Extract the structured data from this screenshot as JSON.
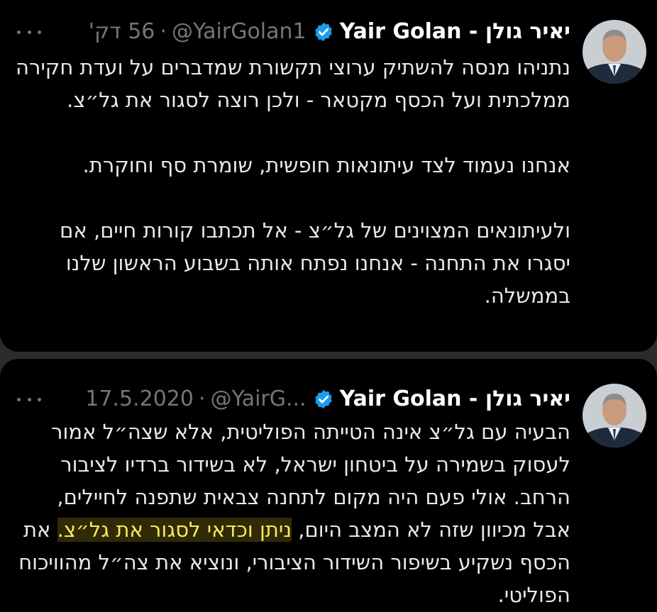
{
  "tweets": [
    {
      "author_name": "Yair Golan - יאיר גולן",
      "handle": "@YairGolan1",
      "time": "56 דק'",
      "paragraphs": [
        "נתניהו מנסה להשתיק ערוצי תקשורת שמדברים על ועדת חקירה ממלכתית ועל הכסף מקטאר - ולכן רוצה לסגור את גל״צ.",
        "אנחנו נעמוד לצד עיתונאות חופשית, שומרת סף וחוקרת.",
        "ולעיתונאים המצוינים של גל״צ - אל תכתבו קורות חיים, אם יסגרו את התחנה - אנחנו נפתח אותה בשבוע הראשון שלנו בממשלה."
      ]
    },
    {
      "author_name": "Yair Golan - יאיר גולן",
      "handle": "@YairG...",
      "time": "17.5.2020",
      "text_before_highlight": "הבעיה עם גל״צ אינה הטייתה הפוליטית, אלא שצה״ל אמור לעסוק בשמירה על ביטחון ישראל, לא בשידור ברדיו לציבור הרחב. אולי פעם היה מקום לתחנה צבאית שתפנה לחיילים, אבל מכיוון שזה לא המצב היום, ",
      "highlight": "ניתן וכדאי לסגור את גל״צ.",
      "text_after_highlight": " את הכסף נשקיע בשיפור השידור הציבורי, ונוציא את צה״ל מהוויכוח הפוליטי."
    }
  ],
  "icons": {
    "verified": "verified-badge-icon",
    "more": "more-options-icon",
    "avatar": "profile-avatar"
  },
  "colors": {
    "background": "#000000",
    "text": "#e7e9ea",
    "muted": "#71767b",
    "verified": "#1d9bf0",
    "highlight_text": "#f6ea5a"
  }
}
